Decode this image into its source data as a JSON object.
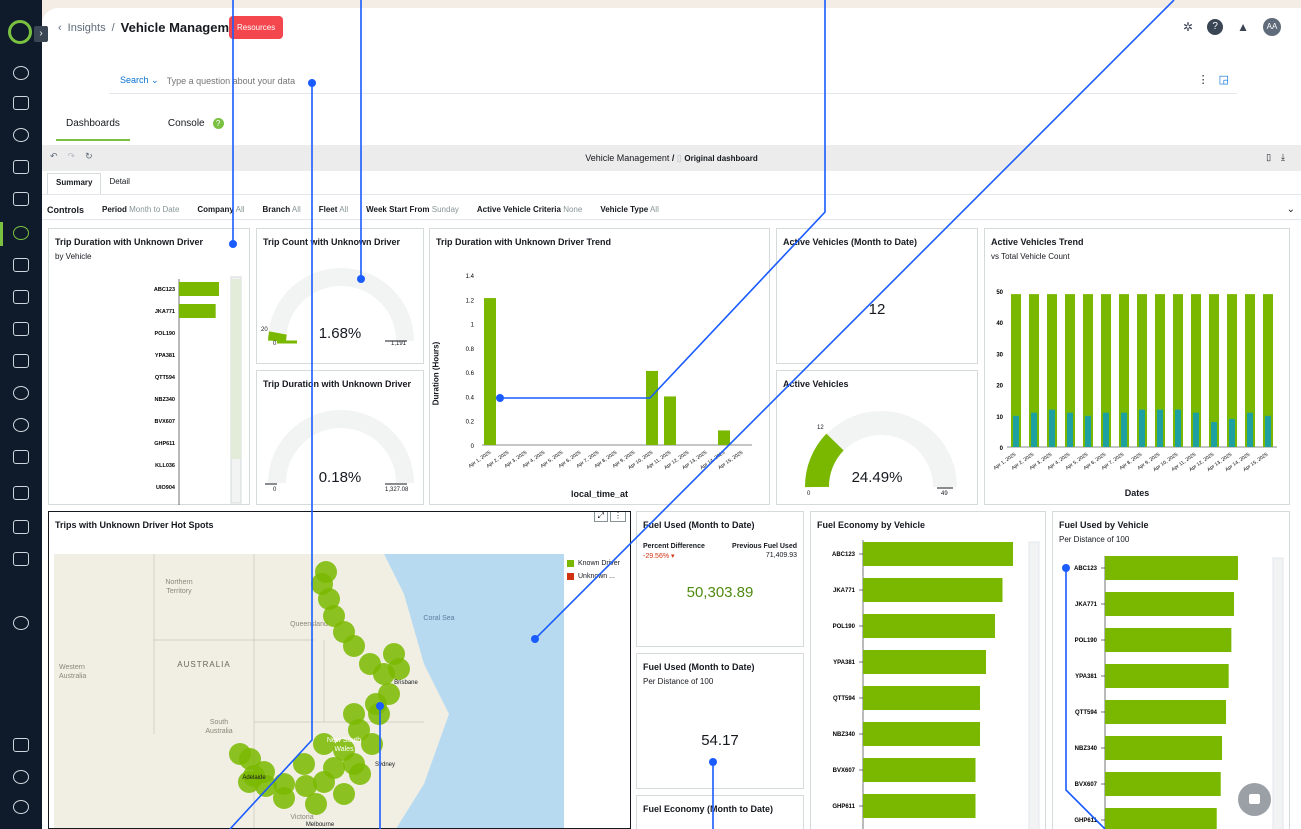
{
  "header": {
    "breadcrumb_parent": "Insights",
    "title": "Vehicle Management",
    "resources_label": "Resources",
    "avatar": "AA",
    "help": "?"
  },
  "search": {
    "label": "Search",
    "placeholder": "Type a question about your data"
  },
  "tabs": {
    "dashboards": "Dashboards",
    "console": "Console"
  },
  "dashbar": {
    "title": "Vehicle Management",
    "sep": "/",
    "original": "Original dashboard"
  },
  "subtabs": {
    "summary": "Summary",
    "detail": "Detail"
  },
  "controls": {
    "title": "Controls",
    "items": [
      {
        "label": "Period",
        "value": "Month to Date"
      },
      {
        "label": "Company",
        "value": "All"
      },
      {
        "label": "Branch",
        "value": "All"
      },
      {
        "label": "Fleet",
        "value": "All"
      },
      {
        "label": "Week Start From",
        "value": "Sunday"
      },
      {
        "label": "Active Vehicle Criteria",
        "value": "None"
      },
      {
        "label": "Vehicle Type",
        "value": "All"
      }
    ]
  },
  "cards": {
    "trip_duration_by_vehicle": {
      "title": "Trip Duration with Unknown Driver",
      "subtitle": "by Vehicle"
    },
    "trip_count": {
      "title": "Trip Count with Unknown Driver",
      "value": "1.68%",
      "min": "0",
      "max": "1,191",
      "current": "20"
    },
    "trip_duration_gauge": {
      "title": "Trip Duration with Unknown Driver",
      "value": "0.18%",
      "min": "0",
      "max": "1,327.08"
    },
    "trend": {
      "title": "Trip Duration with Unknown Driver Trend",
      "xlabel": "local_time_at",
      "ylabel": "Duration (Hours)"
    },
    "active_mtd": {
      "title": "Active Vehicles (Month to Date)",
      "value": "12"
    },
    "active_gauge": {
      "title": "Active Vehicles",
      "value": "24.49%",
      "min": "0",
      "max": "49",
      "current": "12"
    },
    "active_trend": {
      "title": "Active Vehicles Trend",
      "subtitle": "vs Total Vehicle Count",
      "xlabel": "Dates"
    },
    "hotspots": {
      "title": "Trips with Unknown Driver Hot Spots",
      "legend": [
        "Known Driver",
        "Unknown ..."
      ]
    },
    "fuel_used_mtd": {
      "title": "Fuel Used (Month to Date)",
      "pct_label": "Percent Difference",
      "pct_value": "-29.56%",
      "prev_label": "Previous Fuel Used",
      "prev_value": "71,409.93",
      "value": "50,303.89"
    },
    "fuel_used_per100": {
      "title": "Fuel Used (Month to Date)",
      "subtitle": "Per Distance of 100",
      "value": "54.17"
    },
    "fuel_economy_mtd": {
      "title": "Fuel Economy (Month to Date)"
    },
    "fuel_economy_by_vehicle": {
      "title": "Fuel Economy by Vehicle"
    },
    "fuel_used_by_vehicle": {
      "title": "Fuel Used by Vehicle",
      "subtitle": "Per Distance of 100"
    }
  },
  "map_labels": {
    "northern_territory": "Northern\nTerritory",
    "queensland": "Queensland",
    "coral_sea": "Coral Sea",
    "western_australia": "Western\nAustralia",
    "australia": "AUSTRALIA",
    "south_australia": "South\nAustralia",
    "nsw": "New South\nWales",
    "victoria": "Victoria",
    "brisbane": "Brisbane",
    "sydney": "Sydney",
    "adelaide": "Adelaide",
    "melbourne": "Melbourne"
  },
  "chart_data": [
    {
      "type": "bar",
      "title": "Trip Duration with Unknown Driver",
      "subtitle": "by Vehicle",
      "orientation": "horizontal",
      "categories": [
        "ABC123",
        "JKA771",
        "POL190",
        "YPA381",
        "QTT594",
        "NBZ340",
        "BVX607",
        "GHP611",
        "KLL036",
        "UIO904"
      ],
      "values": [
        1.2,
        1.1,
        0,
        0,
        0,
        0,
        0,
        0,
        0,
        0
      ],
      "xticks": [
        "0",
        "0.5",
        "1",
        "1.5"
      ],
      "xlim": [
        0,
        1.5
      ]
    },
    {
      "type": "bar",
      "title": "Trip Duration with Unknown Driver Trend",
      "xlabel": "local_time_at",
      "ylabel": "Duration (Hours)",
      "categories": [
        "Apr 1, 2025",
        "Apr 2, 2025",
        "Apr 3, 2025",
        "Apr 4, 2025",
        "Apr 5, 2025",
        "Apr 6, 2025",
        "Apr 7, 2025",
        "Apr 8, 2025",
        "Apr 9, 2025",
        "Apr 10, 2025",
        "Apr 11, 2025",
        "Apr 12, 2025",
        "Apr 13, 2025",
        "Apr 14, 2025",
        "Apr 15, 2025"
      ],
      "values": [
        1.21,
        0,
        0,
        0,
        0,
        0,
        0,
        0,
        0,
        0.61,
        0.4,
        0,
        0,
        0.12,
        0
      ],
      "yticks": [
        "0",
        "0.2",
        "0.4",
        "0.6",
        "0.8",
        "1",
        "1.2",
        "1.4"
      ],
      "ylim": [
        0,
        1.4
      ]
    },
    {
      "type": "bar",
      "title": "Active Vehicles Trend",
      "subtitle": "vs Total Vehicle Count",
      "xlabel": "Dates",
      "categories": [
        "Apr 1, 2025",
        "Apr 2, 2025",
        "Apr 3, 2025",
        "Apr 4, 2025",
        "Apr 5, 2025",
        "Apr 6, 2025",
        "Apr 7, 2025",
        "Apr 8, 2025",
        "Apr 9, 2025",
        "Apr 10, 2025",
        "Apr 11, 2025",
        "Apr 12, 2025",
        "Apr 13, 2025",
        "Apr 14, 2025",
        "Apr 15, 2025"
      ],
      "series": [
        {
          "values": [
            49,
            49,
            49,
            49,
            49,
            49,
            49,
            49,
            49,
            49,
            49,
            49,
            49,
            49,
            49
          ]
        },
        {
          "values": [
            10,
            11,
            12,
            11,
            10,
            11,
            11,
            12,
            12,
            12,
            11,
            8,
            9,
            11,
            10
          ]
        }
      ],
      "yticks": [
        "0",
        "10",
        "20",
        "30",
        "40",
        "50"
      ],
      "ylim": [
        0,
        50
      ],
      "colors": [
        "#7ab800",
        "#1fa0a0"
      ]
    },
    {
      "type": "bar",
      "title": "Fuel Economy by Vehicle",
      "orientation": "horizontal",
      "categories": [
        "ABC123",
        "JKA771",
        "POL190",
        "YPA381",
        "QTT594",
        "NBZ340",
        "BVX607",
        "GHP611"
      ],
      "values": [
        100,
        93,
        88,
        82,
        78,
        78,
        75,
        75
      ]
    },
    {
      "type": "bar",
      "title": "Fuel Used by Vehicle",
      "subtitle": "Per Distance of 100",
      "orientation": "horizontal",
      "categories": [
        "ABC123",
        "JKA771",
        "POL190",
        "YPA381",
        "QTT594",
        "NBZ340",
        "BVX607",
        "GHP611"
      ],
      "values": [
        100,
        97,
        95,
        93,
        91,
        88,
        87,
        84
      ]
    }
  ],
  "colors": {
    "accent": "#7ab800",
    "secondary": "#1fa0a0",
    "negative": "#d13212",
    "link": "#0972d3"
  }
}
